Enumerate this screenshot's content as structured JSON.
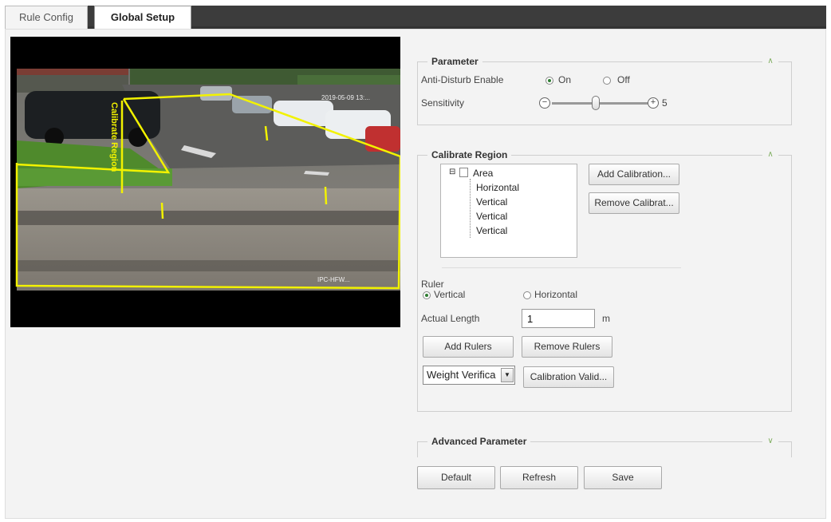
{
  "tabs": [
    {
      "label": "Rule Config",
      "active": false
    },
    {
      "label": "Global Setup",
      "active": true
    }
  ],
  "video": {
    "overlay_label": "Calibrate Region",
    "timestamp_top": "2019-05-09 13:...",
    "timestamp_bottom": "IPC-HFW...",
    "overlay_color": "#f2f200"
  },
  "parameter": {
    "title": "Parameter",
    "anti_disturb_label": "Anti-Disturb Enable",
    "on_label": "On",
    "off_label": "Off",
    "anti_disturb_value": "On",
    "sensitivity_label": "Sensitivity",
    "sensitivity_value": "5",
    "sensitivity_min_icon": "minus-icon",
    "sensitivity_max_icon": "plus-icon"
  },
  "calibrate": {
    "title": "Calibrate Region",
    "tree": {
      "root": "Area",
      "children": [
        "Horizontal",
        "Vertical",
        "Vertical",
        "Vertical"
      ]
    },
    "add_calibration": "Add Calibration...",
    "remove_calibration": "Remove Calibrat...",
    "ruler_label": "Ruler",
    "vertical_label": "Vertical",
    "horizontal_label": "Horizontal",
    "ruler_value": "Vertical",
    "actual_length_label": "Actual Length",
    "actual_length_value": "1",
    "unit": "m",
    "add_rulers": "Add Rulers",
    "remove_rulers": "Remove Rulers",
    "verify_select": "Weight Verifica",
    "calibration_valid": "Calibration Valid..."
  },
  "advanced": {
    "title": "Advanced Parameter"
  },
  "actions": {
    "default": "Default",
    "refresh": "Refresh",
    "save": "Save"
  },
  "colors": {
    "accent": "#7fae60",
    "tab_bar": "#3c3c3c",
    "panel_bg": "#f3f3f3"
  }
}
